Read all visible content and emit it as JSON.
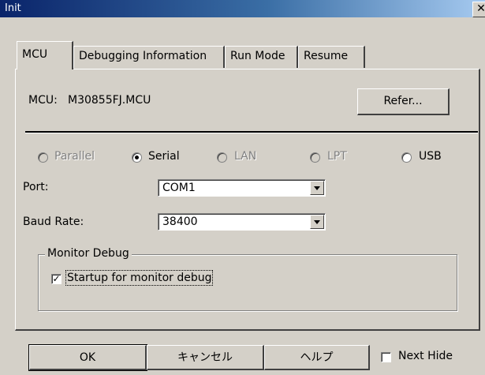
{
  "window": {
    "title": "Init"
  },
  "tabs": [
    {
      "label": "MCU"
    },
    {
      "label": "Debugging Information"
    },
    {
      "label": "Run Mode"
    },
    {
      "label": "Resume"
    }
  ],
  "mcu": {
    "label": "MCU:",
    "value": "M30855FJ.MCU",
    "refer_button": "Refer..."
  },
  "connection": {
    "options": [
      {
        "label": "Parallel",
        "enabled": false,
        "selected": false
      },
      {
        "label": "Serial",
        "enabled": true,
        "selected": true
      },
      {
        "label": "LAN",
        "enabled": false,
        "selected": false
      },
      {
        "label": "LPT",
        "enabled": false,
        "selected": false
      },
      {
        "label": "USB",
        "enabled": true,
        "selected": false
      }
    ]
  },
  "port": {
    "label": "Port:",
    "value": "COM1"
  },
  "baud": {
    "label": "Baud Rate:",
    "value": "38400"
  },
  "monitor_debug": {
    "legend": "Monitor Debug",
    "startup_label": "Startup for monitor debug",
    "startup_checked": true
  },
  "footer": {
    "ok": "OK",
    "cancel": "キャンセル",
    "help": "ヘルプ",
    "next_hide_label": "Next Hide",
    "next_hide_checked": false
  }
}
